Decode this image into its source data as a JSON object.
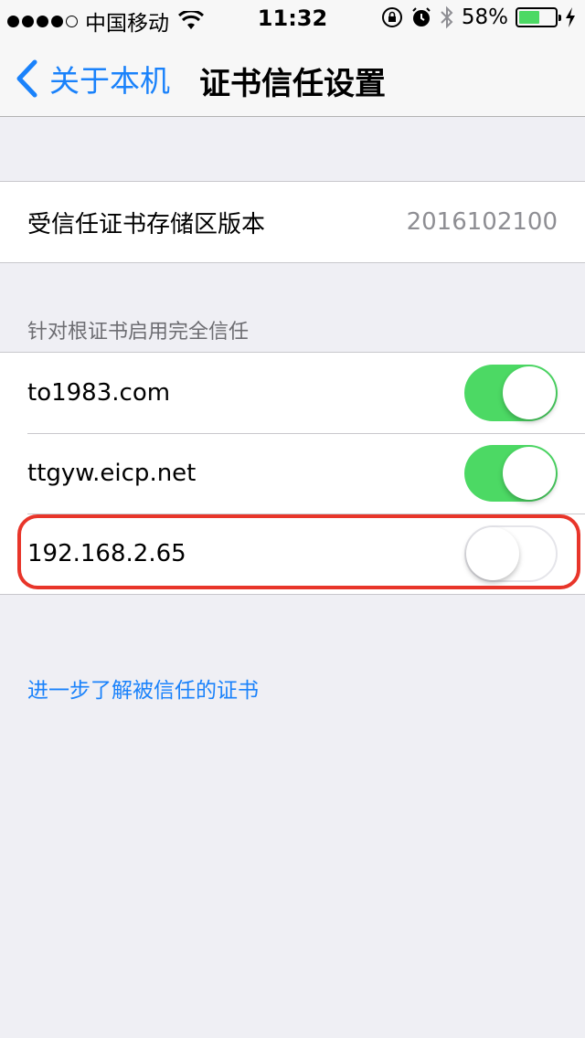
{
  "status_bar": {
    "signal_bars": 4,
    "carrier": "中国移动",
    "wifi_icon": "wifi-icon",
    "time": "11:32",
    "icons": [
      "orientation-lock-icon",
      "alarm-icon",
      "bluetooth-icon"
    ],
    "battery_percent": "58%",
    "battery_level": 0.58,
    "charging_icon": "bolt-icon"
  },
  "nav": {
    "back_label": "关于本机",
    "title": "证书信任设置"
  },
  "trust_store": {
    "label": "受信任证书存储区版本",
    "value": "2016102100"
  },
  "root_section": {
    "header": "针对根证书启用完全信任",
    "items": [
      {
        "name": "to1983.com",
        "enabled": true
      },
      {
        "name": "ttgyw.eicp.net",
        "enabled": true
      },
      {
        "name": "192.168.2.65",
        "enabled": false
      }
    ]
  },
  "footer_link": "进一步了解被信任的证书",
  "colors": {
    "accent": "#1a82fb",
    "switch_on": "#4cd964",
    "highlight": "#e8352a",
    "background": "#efeff4"
  }
}
